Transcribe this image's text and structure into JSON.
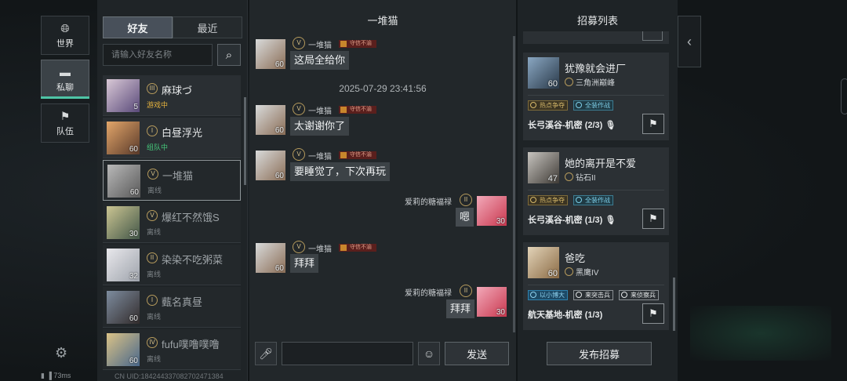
{
  "rail": {
    "items": [
      {
        "label": "世界",
        "icon": "globe-icon"
      },
      {
        "label": "私聊",
        "icon": "chat-bubble-icon"
      },
      {
        "label": "队伍",
        "icon": "flag-icon"
      }
    ],
    "active_index": 1,
    "ping": "73ms"
  },
  "friends": {
    "tabs": [
      "好友",
      "最近"
    ],
    "search_placeholder": "请输入好友名称",
    "items": [
      {
        "name": "麻球づ",
        "rank": "III",
        "status": "游戏中",
        "level": "5"
      },
      {
        "name": "白昼浮光",
        "rank": "I",
        "status": "组队中",
        "level": "60"
      },
      {
        "name": "一堆猫",
        "rank": "V",
        "status": "离线",
        "level": "60"
      },
      {
        "name": "爆红不然饿S",
        "rank": "V",
        "status": "离线",
        "level": "30"
      },
      {
        "name": "染染不吃粥菜",
        "rank": "II",
        "status": "离线",
        "level": "32"
      },
      {
        "name": "薽名真昼",
        "rank": "I",
        "status": "离线",
        "level": "60"
      },
      {
        "name": "fufu噗噜噗噜",
        "rank": "IV",
        "status": "离线",
        "level": "60"
      }
    ],
    "uid": "CN UID:1842443370827024713​84"
  },
  "chat": {
    "title": "一堆猫",
    "timestamp": "2025-07-29 23:41:56",
    "badge_text": "守信不渝",
    "other_name": "一堆猫",
    "me_name": "爱莉的糖福禄",
    "messages": [
      {
        "from": "other",
        "text": "这局全给你"
      },
      {
        "from": "other",
        "text": "太谢谢你了"
      },
      {
        "from": "other",
        "text": "要睡觉了，下次再玩"
      },
      {
        "from": "me",
        "text": "嗯"
      },
      {
        "from": "other",
        "text": "拜拜"
      },
      {
        "from": "me",
        "text": "拜拜"
      }
    ],
    "send_label": "发送"
  },
  "recruit": {
    "title": "招募列表",
    "cards": [
      {
        "name": "犹豫就会进厂",
        "rank": "三角洲巅峰",
        "level": "60",
        "tags": [
          "热点争夺",
          "全装作战"
        ],
        "map": "长弓溪谷-机密 (2/3)",
        "mic": true
      },
      {
        "name": "她的离开是不爱",
        "rank": "钻石II",
        "level": "47",
        "tags": [
          "热点争夺",
          "全装作战"
        ],
        "map": "长弓溪谷-机密 (1/3)",
        "mic": true
      },
      {
        "name": "爸吃",
        "rank": "黑鹰IV",
        "level": "60",
        "tags": [
          "以小博大",
          "来突击兵",
          "来侦察兵"
        ],
        "map": "航天基地-机密 (1/3)",
        "mic": false
      }
    ],
    "publish_label": "发布招募"
  }
}
